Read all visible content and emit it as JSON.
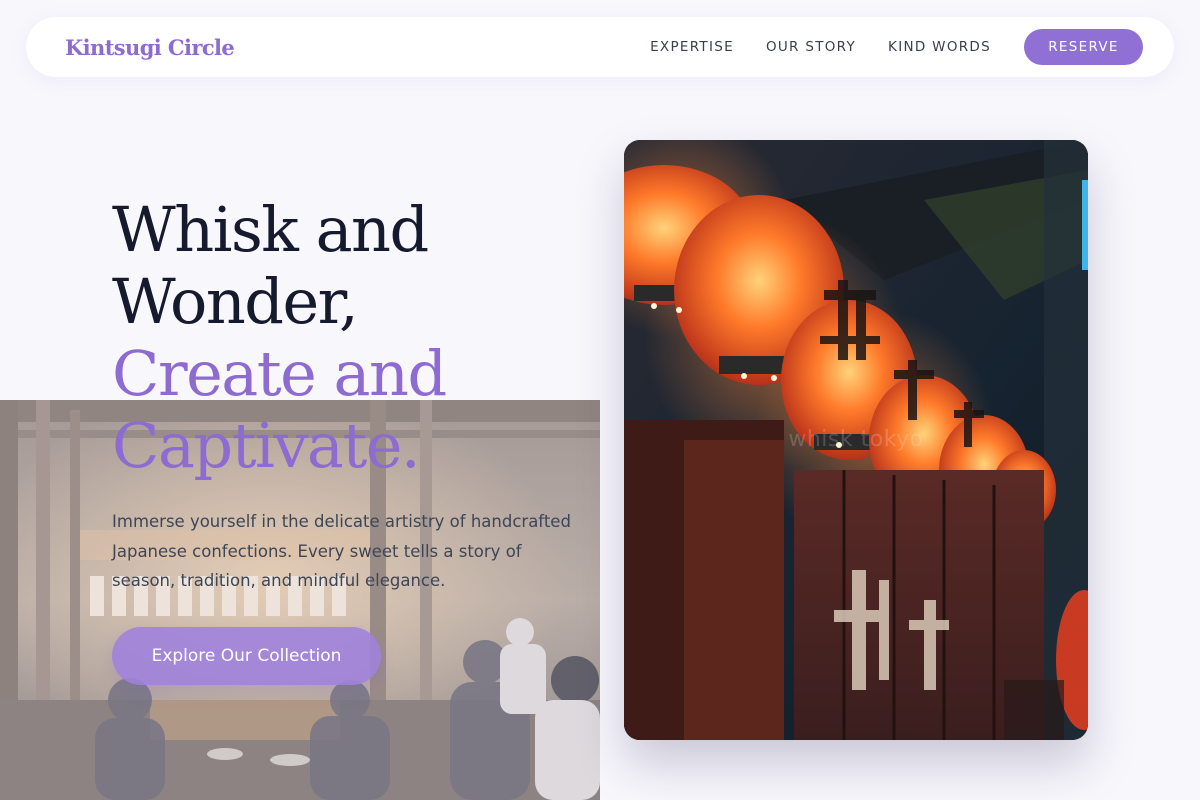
{
  "brand": {
    "name": "Kintsugi Circle"
  },
  "nav": {
    "links": [
      {
        "label": "EXPERTISE"
      },
      {
        "label": "OUR STORY"
      },
      {
        "label": "KIND WORDS"
      }
    ],
    "reserve_label": "RESERVE"
  },
  "hero": {
    "title_line1": "Whisk and",
    "title_line2": "Wonder,",
    "title_line3": "Create and",
    "title_line4": "Captivate.",
    "description": "Immerse yourself in the delicate artistry of handcrafted Japanese confections. Every sweet tells a story of season, tradition, and mindful elegance.",
    "cta_label": "Explore Our Collection"
  },
  "photo": {
    "watermark": "whisk tokyo"
  },
  "colors": {
    "accent": "#8d6bd0",
    "button": "#9170d6",
    "heading": "#151a2e",
    "body_text": "#3e4555",
    "page_background": "#f8f7fc"
  },
  "icons": {
    "background_photo": "restaurant-interior-photo",
    "card_photo": "paper-lanterns-photo"
  }
}
